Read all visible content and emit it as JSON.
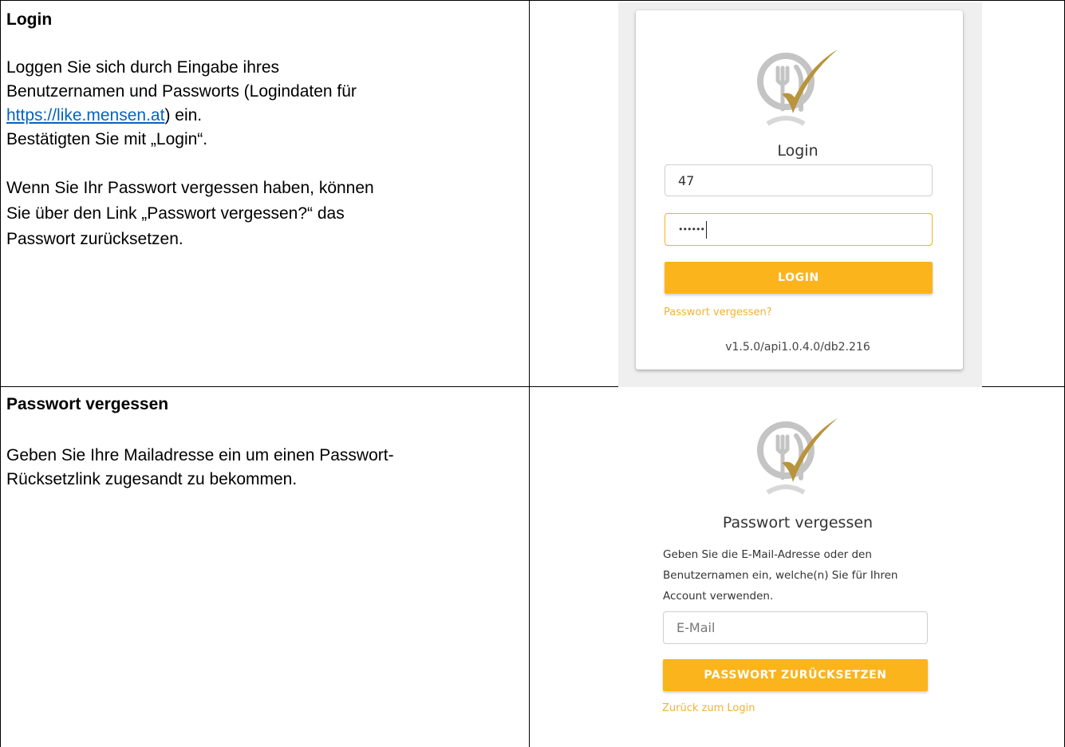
{
  "row1": {
    "title": "Login",
    "text_lines": [
      "Loggen Sie sich durch Eingabe ihres",
      "Benutzernamen und Passworts (Logindaten für"
    ],
    "link": "https://like.mensen.at",
    "after_link": ") ein.",
    "confirm": "Bestätigten Sie mit „Login“.",
    "forgot_lines": [
      "Wenn Sie Ihr Passwort vergessen haben, können",
      "Sie über den Link „Passwort vergessen?“ das",
      "Passwort zurücksetzen."
    ]
  },
  "row2": {
    "title": "Passwort vergessen",
    "text_lines": [
      "Geben Sie Ihre Mailadresse ein um einen Passwort-",
      "Rücksetzlink zugesandt zu bekommen."
    ]
  },
  "login_panel": {
    "title": "Login",
    "username_value": "47",
    "password_value": "••••••",
    "button_label": "LOGIN",
    "forgot_link": "Passwort vergessen?",
    "version": "v1.5.0/api1.0.4.0/db2.216"
  },
  "forgot_panel": {
    "title": "Passwort vergessen",
    "description_lines": [
      "Geben Sie die E-Mail-Adresse oder den",
      "Benutzernamen ein, welche(n) Sie für Ihren",
      "Account verwenden."
    ],
    "email_placeholder": "E-Mail",
    "button_label": "PASSWORT ZURÜCKSETZEN",
    "back_link": "Zurück zum Login"
  },
  "colors": {
    "accent": "#fbb41c",
    "link_blue": "#0563c1",
    "logo_gold": "#b8943c",
    "logo_grey": "#c4c4c4"
  }
}
